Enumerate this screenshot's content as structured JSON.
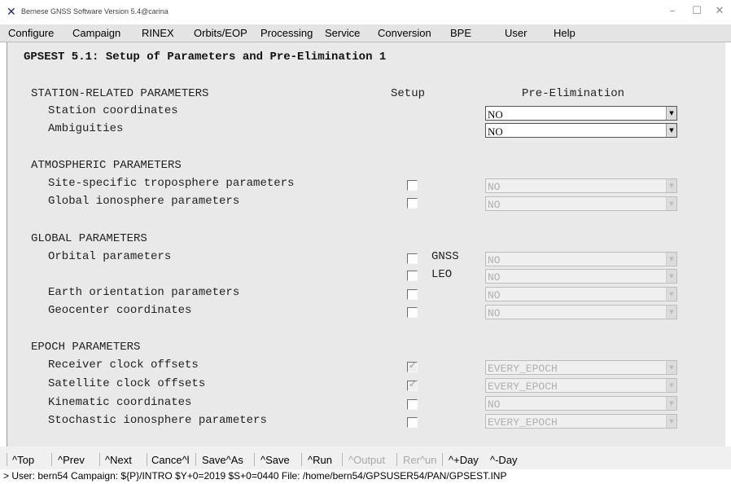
{
  "window": {
    "title": "Bernese GNSS Software Version 5.4@carina",
    "minimize": "–",
    "maximize": "☐",
    "close": "✕"
  },
  "menu": [
    "Configure",
    "Campaign",
    "RINEX",
    "Orbits/EOP",
    "Processing",
    "Service",
    "Conversion",
    "BPE",
    "User",
    "Help"
  ],
  "panel": {
    "title": "GPSEST 5.1: Setup of Parameters and Pre-Elimination 1",
    "col_setup": "Setup",
    "col_preelim": "Pre-Elimination",
    "sections": {
      "station": "STATION-RELATED PARAMETERS",
      "atmos": "ATMOSPHERIC PARAMETERS",
      "global": "GLOBAL PARAMETERS",
      "epoch": "EPOCH PARAMETERS"
    },
    "rows": {
      "station_coords": {
        "label": "Station coordinates",
        "pre": "NO"
      },
      "ambiguities": {
        "label": "Ambiguities",
        "pre": "NO"
      },
      "tropo": {
        "label": "Site-specific troposphere parameters",
        "pre": "NO",
        "checked": false
      },
      "iono": {
        "label": "Global ionosphere parameters",
        "pre": "NO",
        "checked": false
      },
      "orbital": {
        "label": "Orbital parameters",
        "sub1": "GNSS",
        "pre1": "NO",
        "sub2": "LEO",
        "pre2": "NO"
      },
      "eop": {
        "label": "Earth orientation parameters",
        "pre": "NO",
        "checked": false
      },
      "geocenter": {
        "label": "Geocenter coordinates",
        "pre": "NO",
        "checked": false
      },
      "rcv_clock": {
        "label": "Receiver clock offsets",
        "pre": "EVERY_EPOCH",
        "checked": true,
        "mark": "✓"
      },
      "sat_clock": {
        "label": "Satellite clock offsets",
        "pre": "EVERY_EPOCH",
        "checked": true,
        "mark": "✓"
      },
      "kinematic": {
        "label": "Kinematic coordinates",
        "pre": "NO",
        "checked": false
      },
      "stoch_iono": {
        "label": "Stochastic ionosphere parameters",
        "pre": "EVERY_EPOCH",
        "checked": false
      }
    },
    "arrow_glyph": "▼"
  },
  "buttons": {
    "top": "^Top",
    "prev": "^Prev",
    "next": "^Next",
    "cancel": "Cance^l",
    "saveas": "Save^As",
    "save": "^Save",
    "run": "^Run",
    "output": "^Output",
    "rerun": "Rer^un",
    "plusday": "^+Day",
    "minusday": "^-Day"
  },
  "status": "> User: bern54  Campaign: ${P}/INTRO  $Y+0=2019  $S+0=0440  File: /home/bern54/GPSUSER54/PAN/GPSEST.INP"
}
